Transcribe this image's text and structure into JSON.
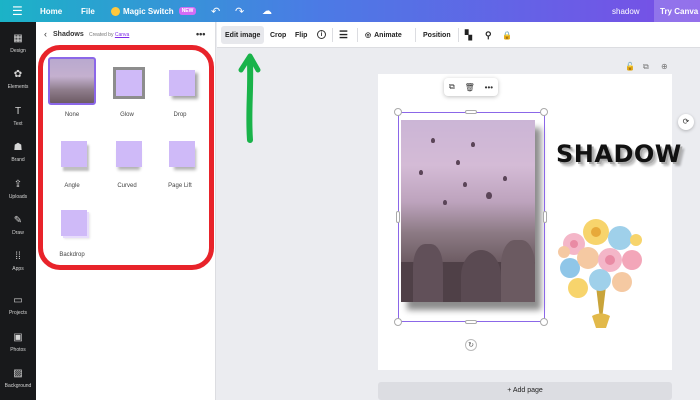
{
  "topbar": {
    "menu_icon": "☰",
    "home_label": "Home",
    "file_label": "File",
    "magic_switch_label": "Magic Switch",
    "magic_badge": "NEW",
    "undo_icon": "↶",
    "redo_icon": "↷",
    "cloud_icon": "☁",
    "doc_title": "shadow",
    "try_label": "Try Canva"
  },
  "rail": {
    "items": [
      {
        "label": "Design",
        "icon": "▦"
      },
      {
        "label": "Elements",
        "icon": "✿"
      },
      {
        "label": "Text",
        "icon": "T"
      },
      {
        "label": "Brand",
        "icon": "☗"
      },
      {
        "label": "Uploads",
        "icon": "⇪"
      },
      {
        "label": "Draw",
        "icon": "✎"
      },
      {
        "label": "Apps",
        "icon": "⁞⁞"
      },
      {
        "label": "Projects",
        "icon": "▭"
      },
      {
        "label": "Photos",
        "icon": "▣"
      },
      {
        "label": "Background",
        "icon": "▨"
      }
    ]
  },
  "panel": {
    "back_icon": "‹",
    "title": "Shadows",
    "created_by": "Created by",
    "creator": "Canva",
    "more_icon": "•••",
    "effects": [
      "None",
      "Glow",
      "Drop",
      "Angle",
      "Curved",
      "Page Lift",
      "Backdrop"
    ]
  },
  "toolbar": {
    "edit_image": "Edit image",
    "crop": "Crop",
    "flip": "Flip",
    "info_icon": "i",
    "lines_icon": "☰",
    "animate_icon": "◎",
    "animate": "Animate",
    "position": "Position",
    "transparency_icon": "▚",
    "paint_icon": "⚲",
    "lock_icon": "🔒"
  },
  "canvas": {
    "shadow_text": "SHADOW",
    "add_page": "+ Add page",
    "float_icons": [
      "⧉",
      "🗑",
      "•••"
    ],
    "page_action_icons": [
      "🔓",
      "⧉",
      "⊕"
    ],
    "rotate_icon": "↻",
    "comment_icon": "⟳"
  },
  "annotations": {
    "loop_color": "#e8232a",
    "arrow_color": "#19b34a"
  },
  "colors": {
    "selection": "#8b67e8",
    "shadow_swatch": "#cfbaf8"
  }
}
